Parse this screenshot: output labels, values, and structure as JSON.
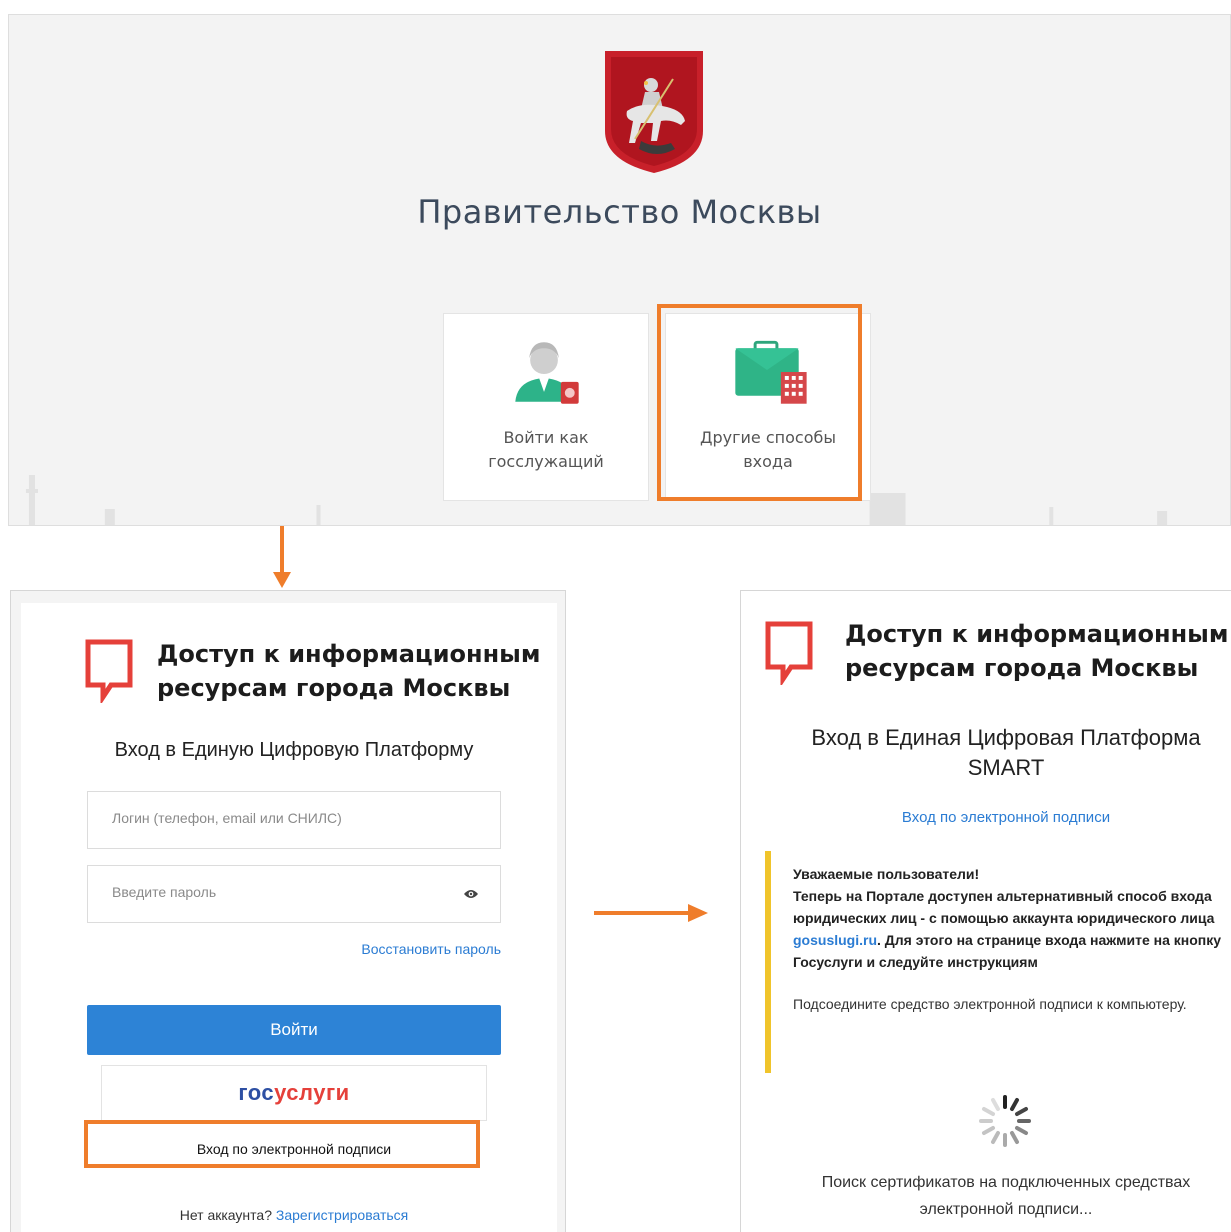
{
  "top": {
    "title": "Правительство Москвы",
    "cards": [
      {
        "label": "Войти как\nгосслужащий"
      },
      {
        "label": "Другие способы\nвхода"
      }
    ]
  },
  "login_panel": {
    "brand_title": "Доступ к информационным\nресурсам города Москвы",
    "subtitle": "Вход в Единую Цифровую Платформу",
    "login_placeholder": "Логин (телефон, email или СНИЛС)",
    "password_placeholder": "Введите пароль",
    "forgot_password": "Восстановить пароль",
    "submit_label": "Войти",
    "gosuslugi_part1": "гос",
    "gosuslugi_part2": "услуги",
    "eds_button": "Вход по электронной подписи",
    "no_account": "Нет аккаунта?",
    "register_link": "Зарегистрироваться"
  },
  "eds_panel": {
    "brand_title": "Доступ к информационным\nресурсам города Москвы",
    "subtitle": "Вход в Единая Цифровая Платформа\nSMART",
    "eds_link": "Вход по электронной подписи",
    "notice_title": "Уважаемые пользователи!",
    "notice_text_1": "Теперь на Портале доступен альтернативный способ входа юридических лиц - с помощью аккаунта юридического лица",
    "notice_link": "gosuslugi.ru",
    "notice_text_2": ". Для этого на странице входа нажмите на кнопку Госуслуги и следуйте инструкциям",
    "notice_hint": "Подсоедините средство электронной подписи к компьютеру.",
    "search_text": "Поиск сертификатов на подключенных средствах\nэлектронной подписи..."
  },
  "colors": {
    "highlight": "#ef7d2b",
    "primary_button": "#2d83d6",
    "brand_red": "#e5403a",
    "notice_bar": "#f0c42b",
    "link": "#2b7cd3"
  },
  "icons": [
    "moscow-coat-of-arms-icon",
    "gov-employee-icon",
    "briefcase-building-icon",
    "speech-bubble-logo-icon",
    "eye-icon",
    "spinner-icon",
    "arrow-down-icon",
    "arrow-right-icon"
  ]
}
